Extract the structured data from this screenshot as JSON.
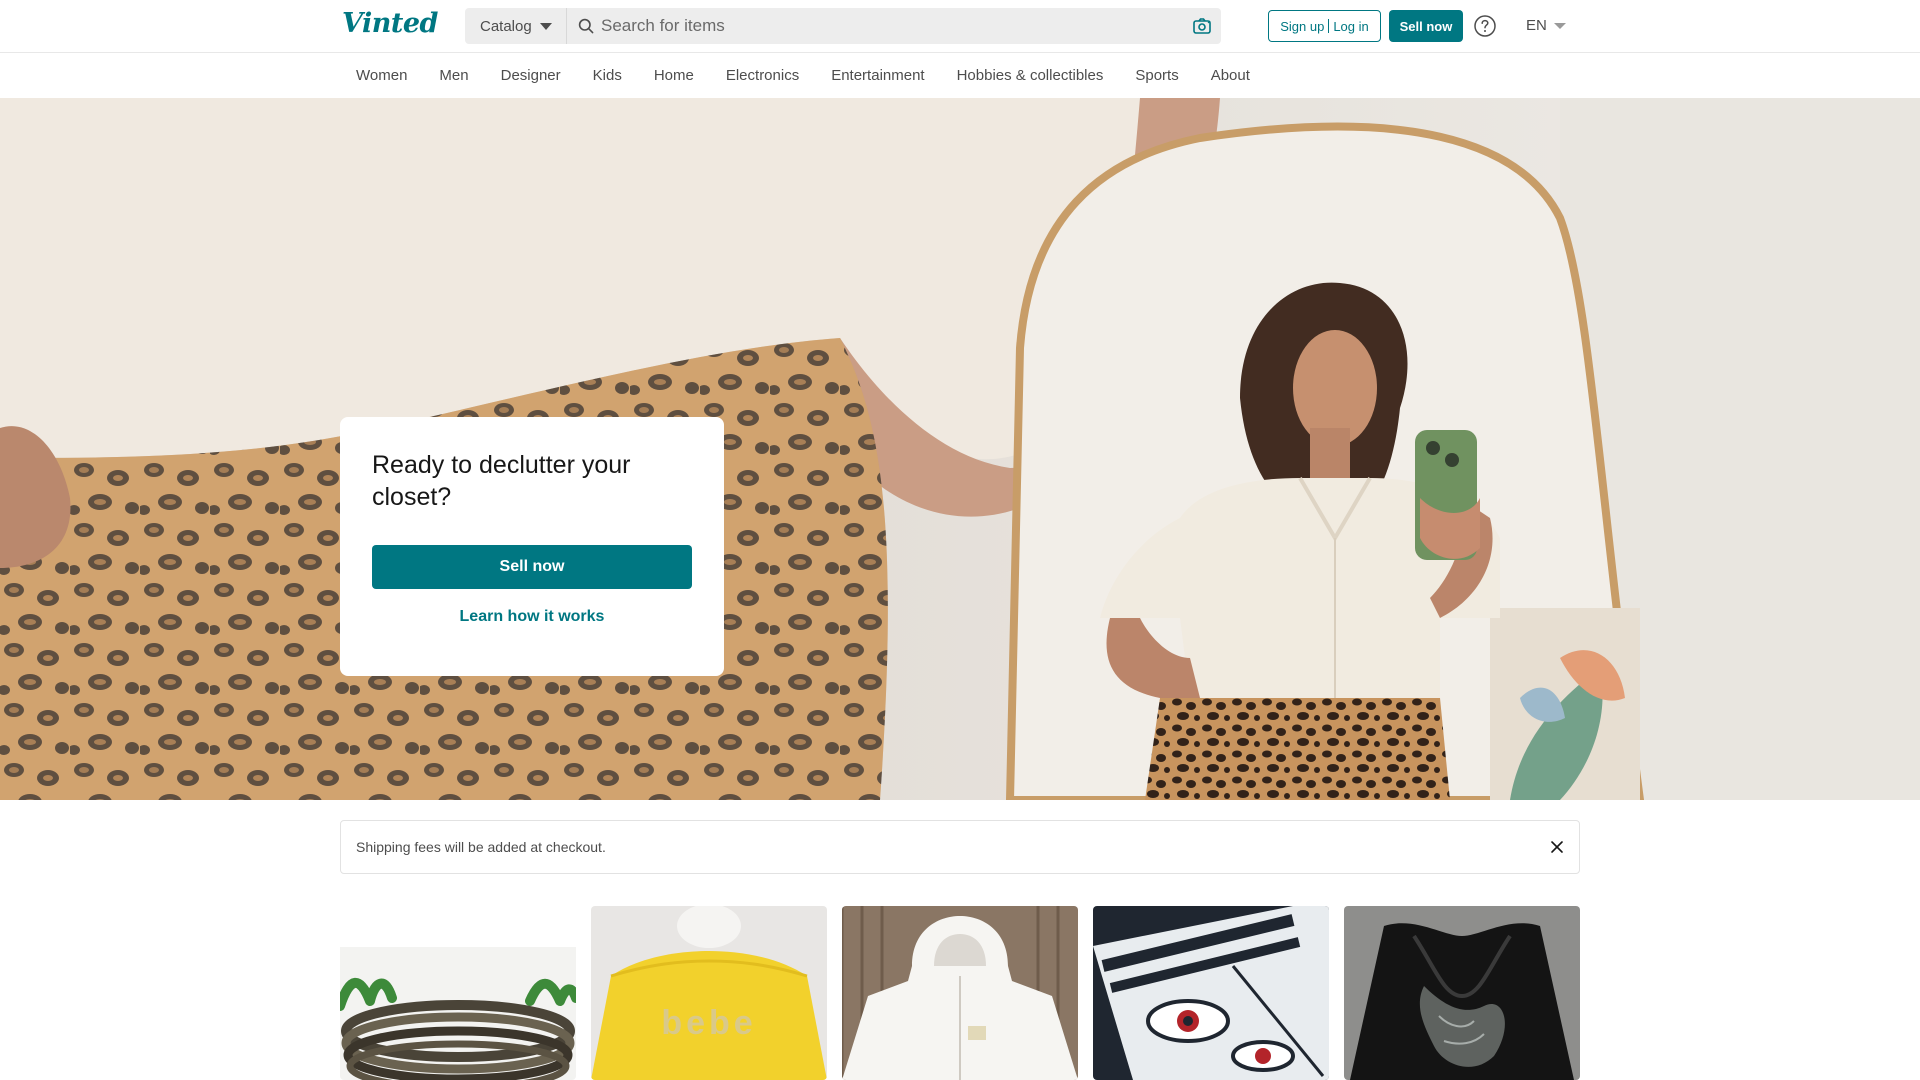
{
  "header": {
    "logo": "Vinted",
    "catalog_label": "Catalog",
    "search_placeholder": "Search for items",
    "signup_label": "Sign up",
    "login_label": "Log in",
    "sell_label": "Sell now",
    "language": "EN",
    "icons": {
      "search": "search-icon",
      "camera": "camera-icon",
      "help": "help-icon"
    }
  },
  "categories": [
    "Women",
    "Men",
    "Designer",
    "Kids",
    "Home",
    "Electronics",
    "Entertainment",
    "Hobbies & collectibles",
    "Sports",
    "About"
  ],
  "hero": {
    "title": "Ready to declutter your closet?",
    "sell_button": "Sell now",
    "learn_link": "Learn how it works"
  },
  "notice": {
    "text": "Shipping fees will be added at checkout."
  },
  "items": [
    {
      "kind": "bangles"
    },
    {
      "kind": "yellow-top",
      "print": "bebe"
    },
    {
      "kind": "white-hoodie"
    },
    {
      "kind": "anime-tee"
    },
    {
      "kind": "black-lace-top"
    }
  ],
  "colors": {
    "brand": "#007782",
    "text": "#171717",
    "muted": "#4d4d4d",
    "search_bg": "#ededed"
  }
}
